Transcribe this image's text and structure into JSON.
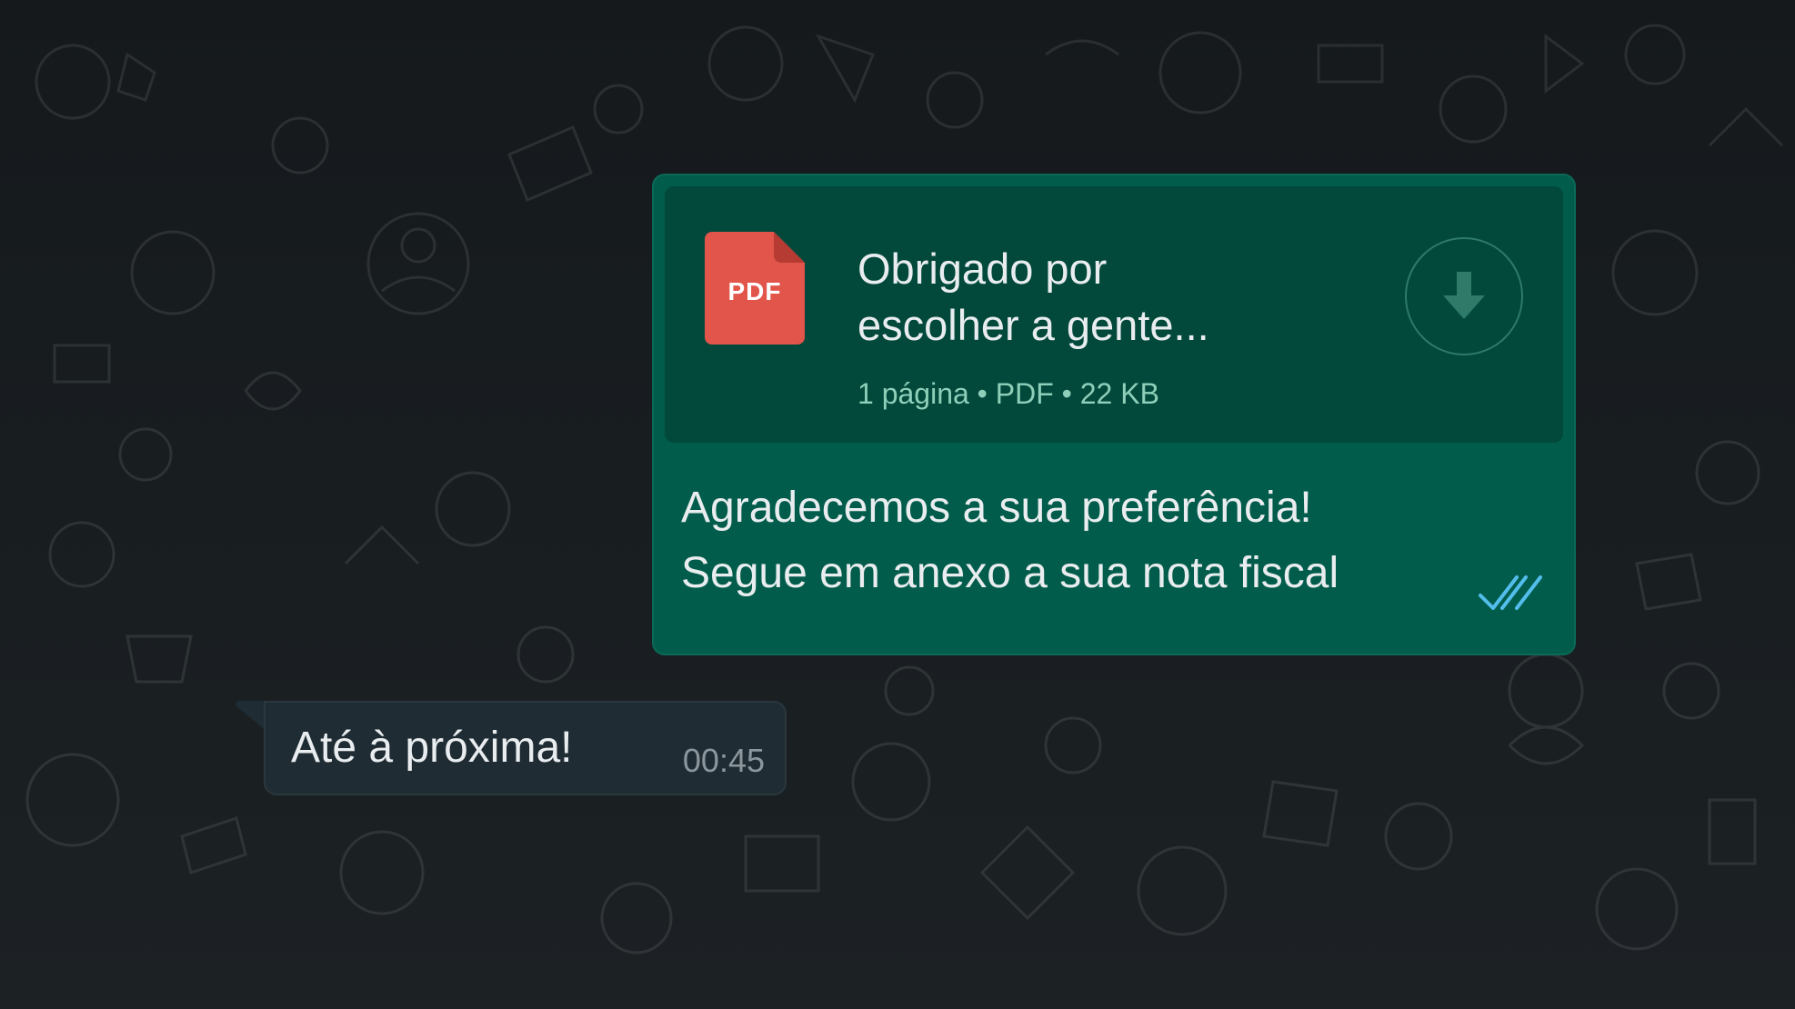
{
  "colors": {
    "outgoing_bubble": "#025c4b",
    "document_card": "#02493c",
    "incoming_bubble": "#1f2c33",
    "pdf_icon": "#e2554b",
    "read_ticks": "#53bdeb"
  },
  "outgoing_message": {
    "document": {
      "icon": "pdf-file-icon",
      "badge": "PDF",
      "title_lines": [
        "Obrigado por",
        "escolher a gente..."
      ],
      "meta": "1 página • PDF • 22 KB",
      "download_icon": "download-arrow-icon"
    },
    "text_lines": [
      "Agradecemos a sua preferência!",
      "Segue em anexo a sua nota fiscal"
    ],
    "status_icon": "double-check-read-icon"
  },
  "incoming_message": {
    "text": "Até à próxima!",
    "time": "00:45"
  }
}
